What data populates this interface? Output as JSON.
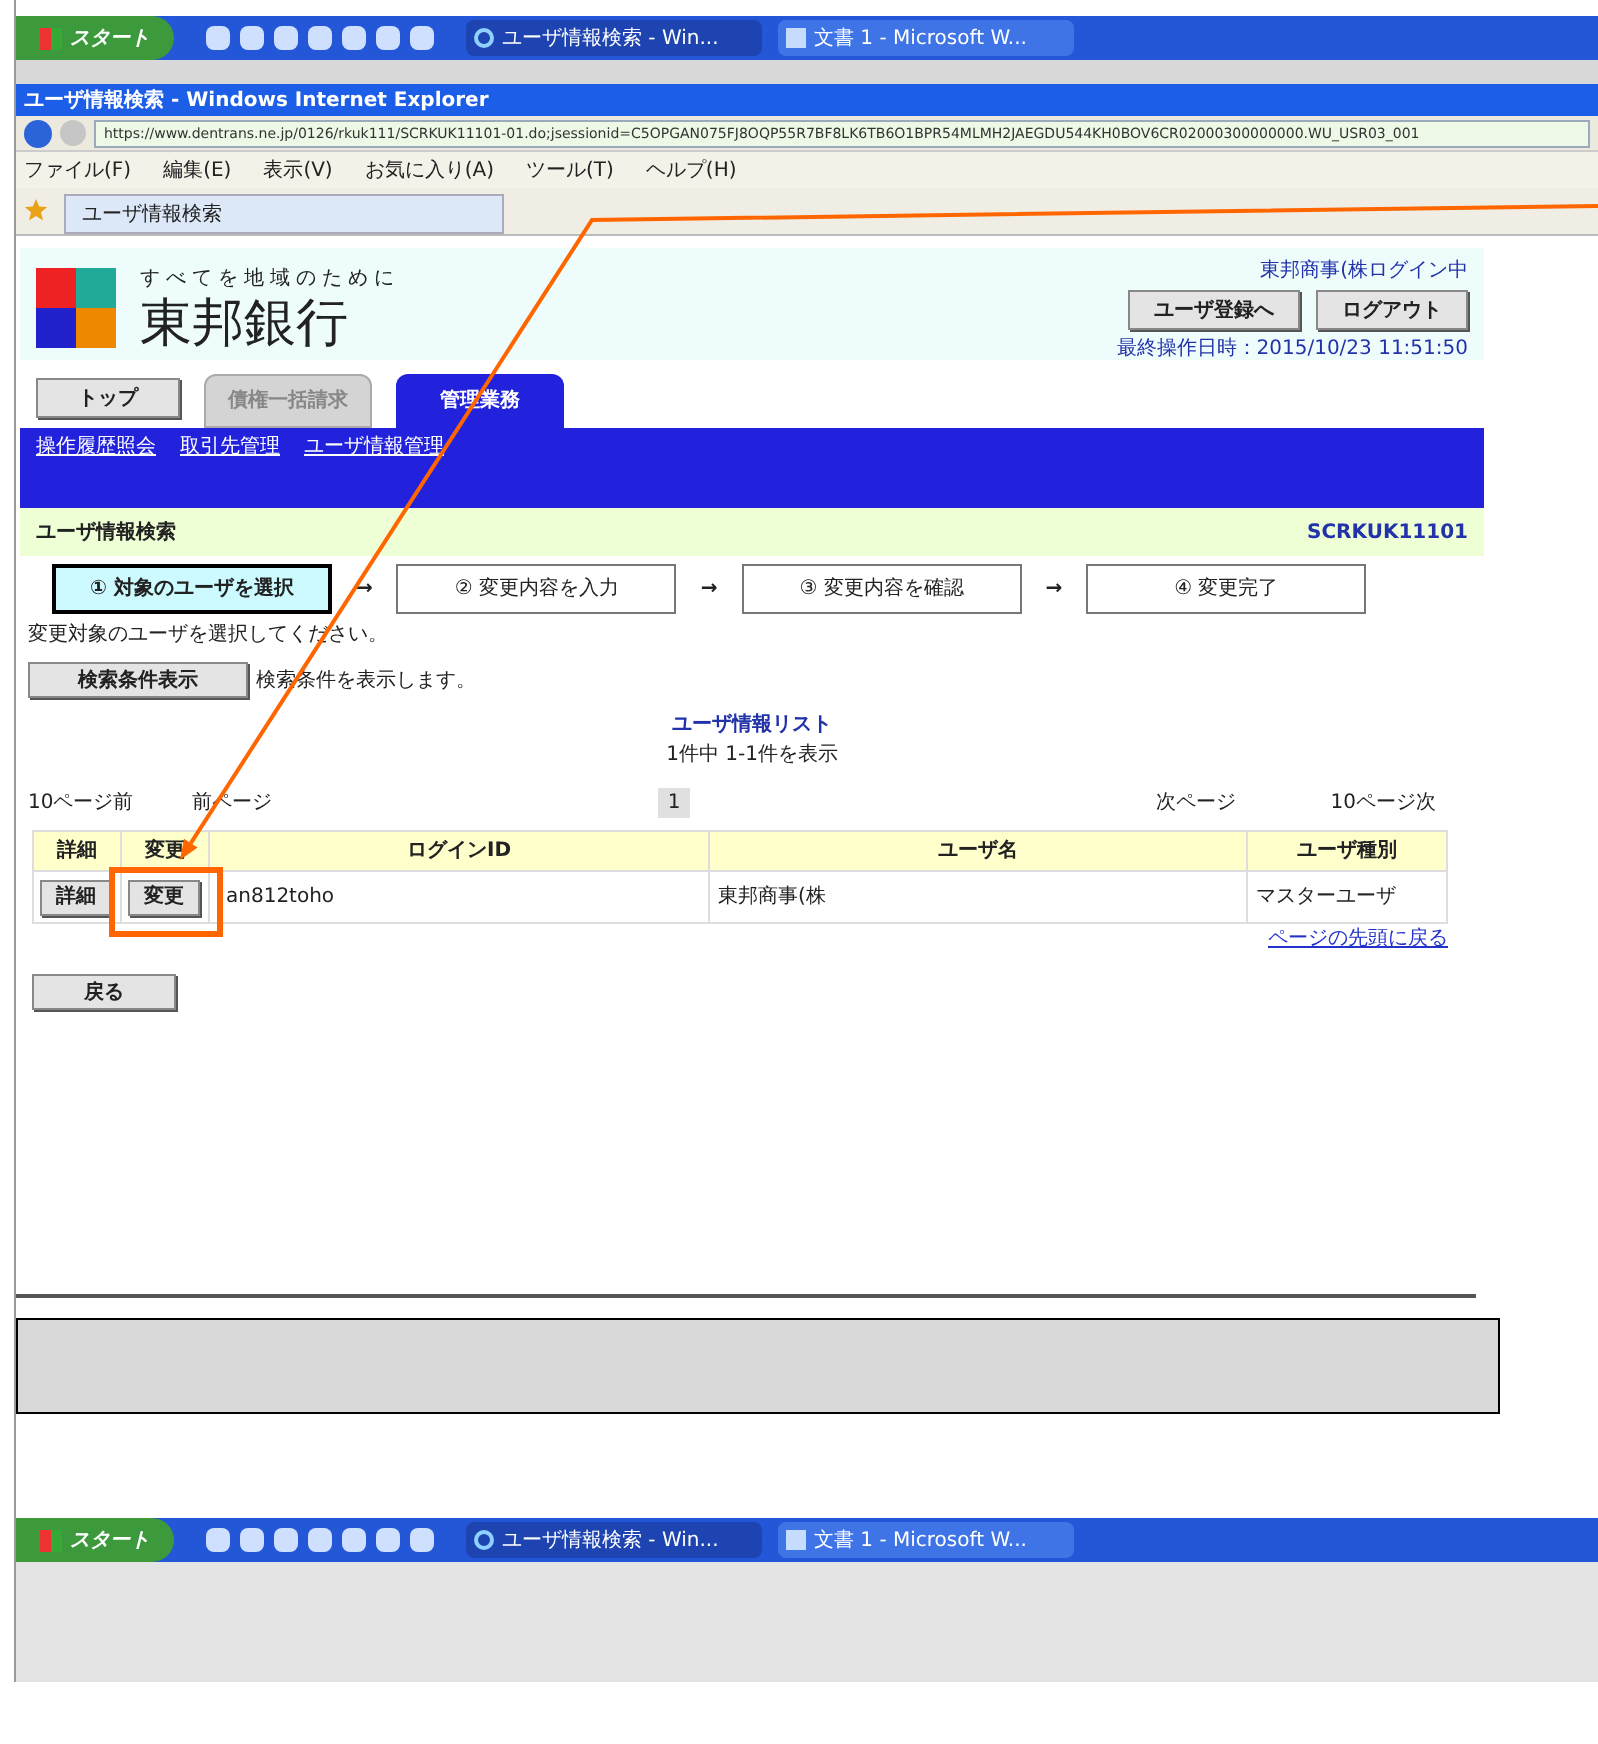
{
  "taskbar_top": {
    "start": "スタート",
    "tasks": [
      {
        "label": "ユーザ情報検索 - Win...",
        "kind": "ie",
        "selected": true
      },
      {
        "label": "文書 1 - Microsoft W...",
        "kind": "word",
        "selected": false
      }
    ]
  },
  "browser": {
    "title": "ユーザ情報検索 - Windows Internet Explorer",
    "url": "https://www.dentrans.ne.jp/0126/rkuk111/SCRKUK11101-01.do;jsessionid=C5OPGAN075FJ8OQP55R7BF8LK6TB6O1BPR54MLMH2JAEGDU544KH0BOV6CR02000300000000.WU_USR03_001",
    "menu": [
      "ファイル(F)",
      "編集(E)",
      "表示(V)",
      "お気に入り(A)",
      "ツール(T)",
      "ヘルプ(H)"
    ],
    "tab": "ユーザ情報検索"
  },
  "page": {
    "tagline": "すべてを地域のために",
    "bank_name": "東邦銀行",
    "login_status": "東邦商事(株ログイン中",
    "header_buttons": [
      "ユーザ登録へ",
      "ログアウト"
    ],
    "last_operation": "最終操作日時：2015/10/23 11:51:50",
    "tabs": [
      {
        "label": "トップ",
        "kind": "button",
        "selected": false
      },
      {
        "label": "債権一括請求",
        "kind": "tab",
        "selected": false
      },
      {
        "label": "管理業務",
        "kind": "tab",
        "selected": true
      }
    ],
    "sub_nav": [
      "操作履歴照会",
      "取引先管理",
      "ユーザ情報管理"
    ],
    "title": "ユーザ情報検索",
    "screen_id": "SCRKUK11101",
    "steps": [
      {
        "label": "① 対象のユーザを選択",
        "selected": true
      },
      {
        "label": "② 変更内容を入力",
        "selected": false
      },
      {
        "label": "③ 変更内容を確認",
        "selected": false
      },
      {
        "label": "④ 変更完了",
        "selected": false
      }
    ],
    "step_arrow": "→",
    "instruction": "変更対象のユーザを選択してください。",
    "search_button": "検索条件表示",
    "search_hint": "検索条件を表示します。",
    "list_title": "ユーザ情報リスト",
    "list_count": "1件中 1-1件を表示",
    "pagination": {
      "prev10": "10ページ前",
      "prev": "前ページ",
      "page": "1",
      "next": "次ページ",
      "next10": "10ページ次"
    },
    "table": {
      "columns": [
        "詳細",
        "変更",
        "ログインID",
        "ユーザ名",
        "ユーザ種別"
      ],
      "rows": [
        {
          "detail": "詳細",
          "change": "変更",
          "login_id": "an812toho",
          "user_name": "東邦商事(株",
          "user_type": "マスターユーザ"
        }
      ]
    },
    "back_to_top": "ページの先頭に戻る",
    "back_button": "戻る"
  },
  "taskbar_bottom": {
    "start": "スタート",
    "tasks": [
      {
        "label": "ユーザ情報検索 - Win...",
        "kind": "ie",
        "selected": true
      },
      {
        "label": "文書 1 - Microsoft W...",
        "kind": "word",
        "selected": false
      }
    ]
  }
}
